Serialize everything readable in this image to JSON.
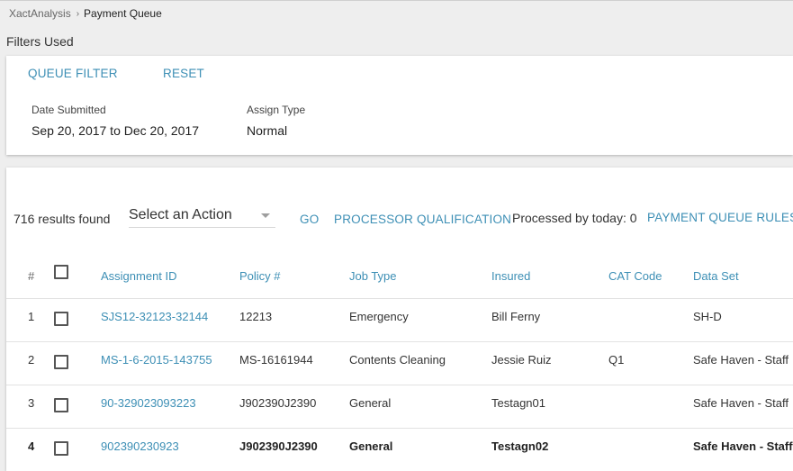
{
  "breadcrumb": {
    "root": "XactAnalysis",
    "separator": "›",
    "current": "Payment Queue"
  },
  "filters_used_label": "Filters Used",
  "filters": {
    "queue_filter_label": "QUEUE FILTER",
    "reset_label": "RESET",
    "fields": [
      {
        "label": "Date Submitted",
        "value": "Sep 20, 2017 to Dec 20, 2017"
      },
      {
        "label": "Assign Type",
        "value": "Normal"
      }
    ]
  },
  "results": {
    "count_text": "716 results found",
    "action_select": {
      "value": "Select an Action"
    },
    "go_label": "GO",
    "processor_qualification_label": "PROCESSOR QUALIFICATION",
    "processed_today": "Processed by today: 0",
    "payment_queue_rules_label": "PAYMENT QUEUE RULES"
  },
  "table": {
    "columns": [
      "#",
      "Assignment ID",
      "Policy #",
      "Job Type",
      "Insured",
      "CAT Code",
      "Data Set"
    ],
    "rows": [
      {
        "num": "1",
        "assignment_id": "SJS12-32123-32144",
        "policy": "12213",
        "job_type": "Emergency",
        "insured": "Bill Ferny",
        "cat_code": "",
        "data_set": "SH-D",
        "bold": false
      },
      {
        "num": "2",
        "assignment_id": "MS-1-6-2015-143755",
        "policy": "MS-16161944",
        "job_type": "Contents Cleaning",
        "insured": "Jessie Ruiz",
        "cat_code": "Q1",
        "data_set": "Safe Haven - Staff",
        "bold": false
      },
      {
        "num": "3",
        "assignment_id": "90-329023093223",
        "policy": "J902390J2390",
        "job_type": "General",
        "insured": "Testagn01",
        "cat_code": "",
        "data_set": "Safe Haven - Staff",
        "bold": false
      },
      {
        "num": "4",
        "assignment_id": "902390230923",
        "policy": "J902390J2390",
        "job_type": "General",
        "insured": "Testagn02",
        "cat_code": "",
        "data_set": "Safe Haven - Staff",
        "bold": true
      }
    ]
  },
  "colors": {
    "accent": "#3d8fb5",
    "background": "#eeeeee",
    "card": "#ffffff"
  },
  "icons": {
    "breadcrumb_separator": "chevron-right-icon",
    "select_caret": "caret-down-icon"
  }
}
